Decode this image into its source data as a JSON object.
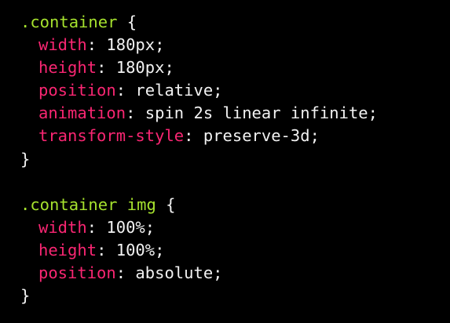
{
  "theme": {
    "background": "#000000",
    "selector_color": "#a6e22e",
    "property_color": "#f92672",
    "value_color": "#f2f2f2"
  },
  "code": {
    "rule1": {
      "selector": ".container",
      "open": " {",
      "decls": [
        {
          "prop": "width",
          "val": ": 180px;"
        },
        {
          "prop": "height",
          "val": ": 180px;"
        },
        {
          "prop": "position",
          "val": ": relative;"
        },
        {
          "prop": "animation",
          "val": ": spin 2s linear infinite;"
        },
        {
          "prop": "transform-style",
          "val": ": preserve-3d;"
        }
      ],
      "close": "}"
    },
    "rule2": {
      "selector": ".container img",
      "open": " {",
      "decls": [
        {
          "prop": "width",
          "val": ": 100%;"
        },
        {
          "prop": "height",
          "val": ": 100%;"
        },
        {
          "prop": "position",
          "val": ": absolute;"
        }
      ],
      "close": "}"
    }
  }
}
